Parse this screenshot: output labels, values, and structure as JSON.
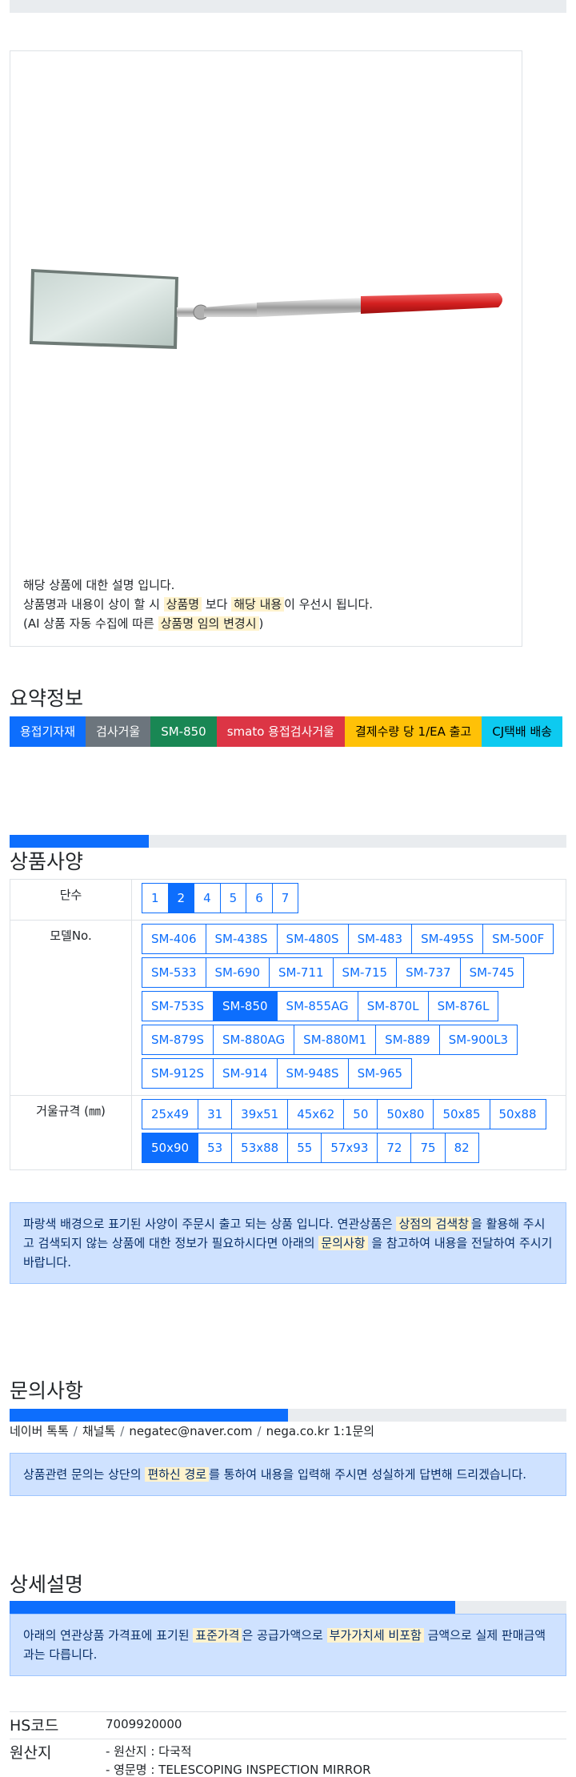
{
  "product": {
    "desc_line1": "해당 상품에 대한 설명 입니다.",
    "desc_line2_a": "상품명과 내용이 상이 할 시 ",
    "desc_line2_hl1": "상품명",
    "desc_line2_b": " 보다 ",
    "desc_line2_hl2": "해당 내용",
    "desc_line2_c": "이 우선시 됩니다.",
    "desc_line3_a": "(AI 상품 자동 수집에 따른 ",
    "desc_line3_hl": "상품명 임의 변경시",
    "desc_line3_b": ")"
  },
  "summary": {
    "title": "요약정보",
    "badges": [
      "용접기자재",
      "검사거울",
      "SM-850",
      "smato 용접검사거울",
      "결제수량 당 1/EA 출고",
      "CJ택배 배송"
    ],
    "badge_colors": [
      "#0d6efd",
      "#6c757d",
      "#198754",
      "#dc3545",
      "#ffc107",
      "#0dcaf0"
    ]
  },
  "spec": {
    "title": "상품사양",
    "progress_fraction": 0.25,
    "rows": [
      {
        "label": "단수",
        "options": [
          "1",
          "2",
          "4",
          "5",
          "6",
          "7"
        ],
        "selected": "2"
      },
      {
        "label": "모델No.",
        "options": [
          "SM-406",
          "SM-438S",
          "SM-480S",
          "SM-483",
          "SM-495S",
          "SM-500F",
          "SM-533",
          "SM-690",
          "SM-711",
          "SM-715",
          "SM-737",
          "SM-745",
          "SM-753S",
          "SM-850",
          "SM-855AG",
          "SM-870L",
          "SM-876L",
          "SM-879S",
          "SM-880AG",
          "SM-880M1",
          "SM-889",
          "SM-900L3",
          "SM-912S",
          "SM-914",
          "SM-948S",
          "SM-965"
        ],
        "selected": "SM-850"
      },
      {
        "label": "거울규격 (㎜)",
        "options": [
          "25x49",
          "31",
          "39x51",
          "45x62",
          "50",
          "50x80",
          "50x85",
          "50x88",
          "50x90",
          "53",
          "53x88",
          "55",
          "57x93",
          "72",
          "75",
          "82"
        ],
        "selected": "50x90"
      }
    ],
    "notice_a": "파랑색 배경으로 표기된 사양이 주문시 출고 되는 상품 입니다. 연관상품은 ",
    "notice_hl1": "상점의 검색창",
    "notice_b": "을 활용해 주시고 검색되지 않는 상품에 대한 정보가 필요하시다면 아래의 ",
    "notice_hl2": "문의사항",
    "notice_c": " 을 참고하여 내용을 전달하여 주시기 바랍니다."
  },
  "inquiry": {
    "title": "문의사항",
    "progress_fraction": 0.5,
    "contacts": [
      "네이버 톡톡",
      "채널톡",
      "negatec@naver.com",
      "nega.co.kr 1:1문의"
    ],
    "separator": "/",
    "notice_a": "상품관련 문의는 상단의 ",
    "notice_hl": "편하신 경로",
    "notice_b": "를 통하여 내용을 입력해 주시면 성실하게 답변해 드리겠습니다."
  },
  "detail": {
    "title": "상세설명",
    "progress_fraction": 0.8,
    "notice_a": "아래의 연관상품 가격표에 표기된 ",
    "notice_hl1": "표준가격",
    "notice_b": "은 공급가액으로 ",
    "notice_hl2": "부가가치세 비포함",
    "notice_c": " 금액으로 실제 판매금액과는 다릅니다.",
    "hs_label": "HS코드",
    "hs_value": "7009920000",
    "origin_label": "원산지",
    "origin_line1": "- 원산지 : 다국적",
    "origin_line2": "- 영문명 : TELESCOPING INSPECTION MIRROR"
  }
}
